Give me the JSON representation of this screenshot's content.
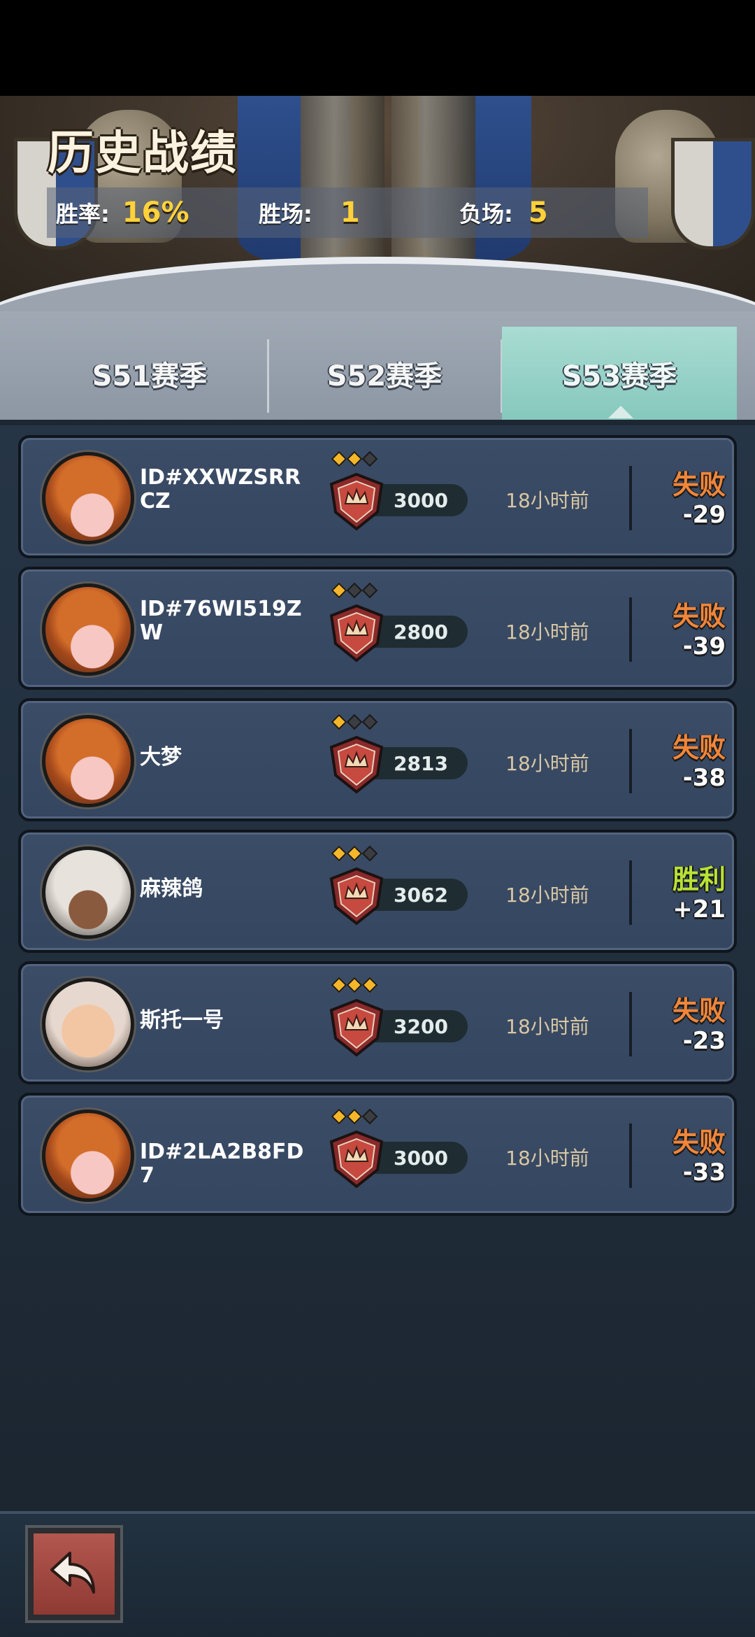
{
  "header": {
    "title": "历史战绩",
    "win_rate_label": "胜率:",
    "win_rate_value": "16%",
    "wins_label": "胜场:",
    "wins_value": "1",
    "losses_label": "负场:",
    "losses_value": "5"
  },
  "tabs": [
    {
      "label": "S51赛季",
      "active": false
    },
    {
      "label": "S52赛季",
      "active": false
    },
    {
      "label": "S53赛季",
      "active": true
    }
  ],
  "records": [
    {
      "avatar": "pumpkin-avatar",
      "name": "ID#XXWZSRRCZ",
      "stars": 2,
      "score": "3000",
      "time": "18小时前",
      "result": "失败",
      "delta": "-29"
    },
    {
      "avatar": "pumpkin-avatar",
      "name": "ID#76WI519ZW",
      "stars": 1,
      "score": "2800",
      "time": "18小时前",
      "result": "失败",
      "delta": "-39"
    },
    {
      "avatar": "pumpkin-avatar",
      "name": "大梦",
      "stars": 1,
      "score": "2813",
      "time": "18小时前",
      "result": "失败",
      "delta": "-38"
    },
    {
      "avatar": "silver-hair-avatar",
      "name": "麻辣鸽",
      "stars": 2,
      "score": "3062",
      "time": "18小时前",
      "result": "胜利",
      "delta": "+21"
    },
    {
      "avatar": "bald-man-avatar",
      "name": "斯托一号",
      "stars": 3,
      "score": "3200",
      "time": "18小时前",
      "result": "失败",
      "delta": "-23"
    },
    {
      "avatar": "pumpkin-avatar",
      "name": "ID#2LA2B8FD7",
      "stars": 2,
      "score": "3000",
      "time": "18小时前",
      "result": "失败",
      "delta": "-33"
    }
  ],
  "bottom_bar": {
    "back_icon": "return-arrow-icon"
  },
  "colors": {
    "loss": "#f0863a",
    "win": "#b8e236",
    "stat_value": "#ffd23b",
    "active_tab": "#9fd6cc"
  }
}
